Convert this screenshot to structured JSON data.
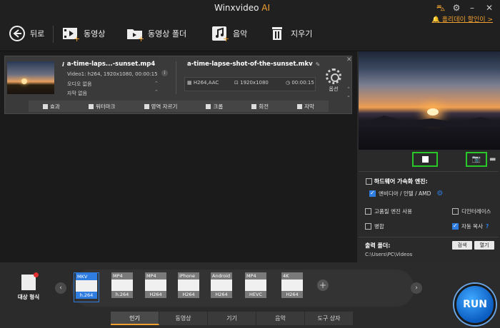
{
  "app": {
    "title": "Winxvideo",
    "title_ai": "AI"
  },
  "toolbar": {
    "back": "뒤로",
    "add_video": "동영상",
    "add_folder": "동영상 폴더",
    "add_music": "음악",
    "clear": "지우기",
    "promo": "홀리데이 할인이 >"
  },
  "file": {
    "name": "a-time-laps...-sunset.mp4",
    "video_info": "Video1: h264, 1920x1080, 00:00:15",
    "audio": "오디오 없음",
    "subtitle": "자막 없음",
    "output_name": "a-time-lapse-shot-of-the-sunset.mkv",
    "codec": "H264,AAC",
    "resolution": "1920x1080",
    "duration": "00:00:15",
    "options_label": "옵션"
  },
  "edit_tools": [
    "효과",
    "워터마크",
    "영역 자르기",
    "크롭",
    "회전",
    "자막"
  ],
  "right": {
    "hw_title": "하드웨어 가속화 엔진:",
    "hw_option": "엔비디아 / 인텔 / AMD",
    "high_quality": "고품질 엔진 사용",
    "deinterlace": "디인터레이스",
    "merge": "병합",
    "auto_copy": "자동 복사",
    "help_mark": "?",
    "output_folder_label": "출력 폴더:",
    "browse": "검색",
    "open": "열기",
    "output_path": "C:\\Users\\PC\\Videos"
  },
  "bottom": {
    "target_format": "대상 형식",
    "formats": [
      {
        "top": "MKV",
        "bottom": "h.264"
      },
      {
        "top": "MP4",
        "bottom": "h.264"
      },
      {
        "top": "MP4",
        "bottom": "H264"
      },
      {
        "top": "iPhone",
        "bottom": "H264"
      },
      {
        "top": "Android",
        "bottom": "H264"
      },
      {
        "top": "MP4",
        "bottom": "HEVC"
      },
      {
        "top": "4K",
        "bottom": "H264"
      }
    ],
    "tabs": [
      "인기",
      "동영상",
      "기기",
      "음악",
      "도구 상자"
    ],
    "run": "RUN"
  },
  "colors": {
    "accent": "#f0a030",
    "selection": "#2f7de1",
    "highlight_box": "#28c828"
  }
}
